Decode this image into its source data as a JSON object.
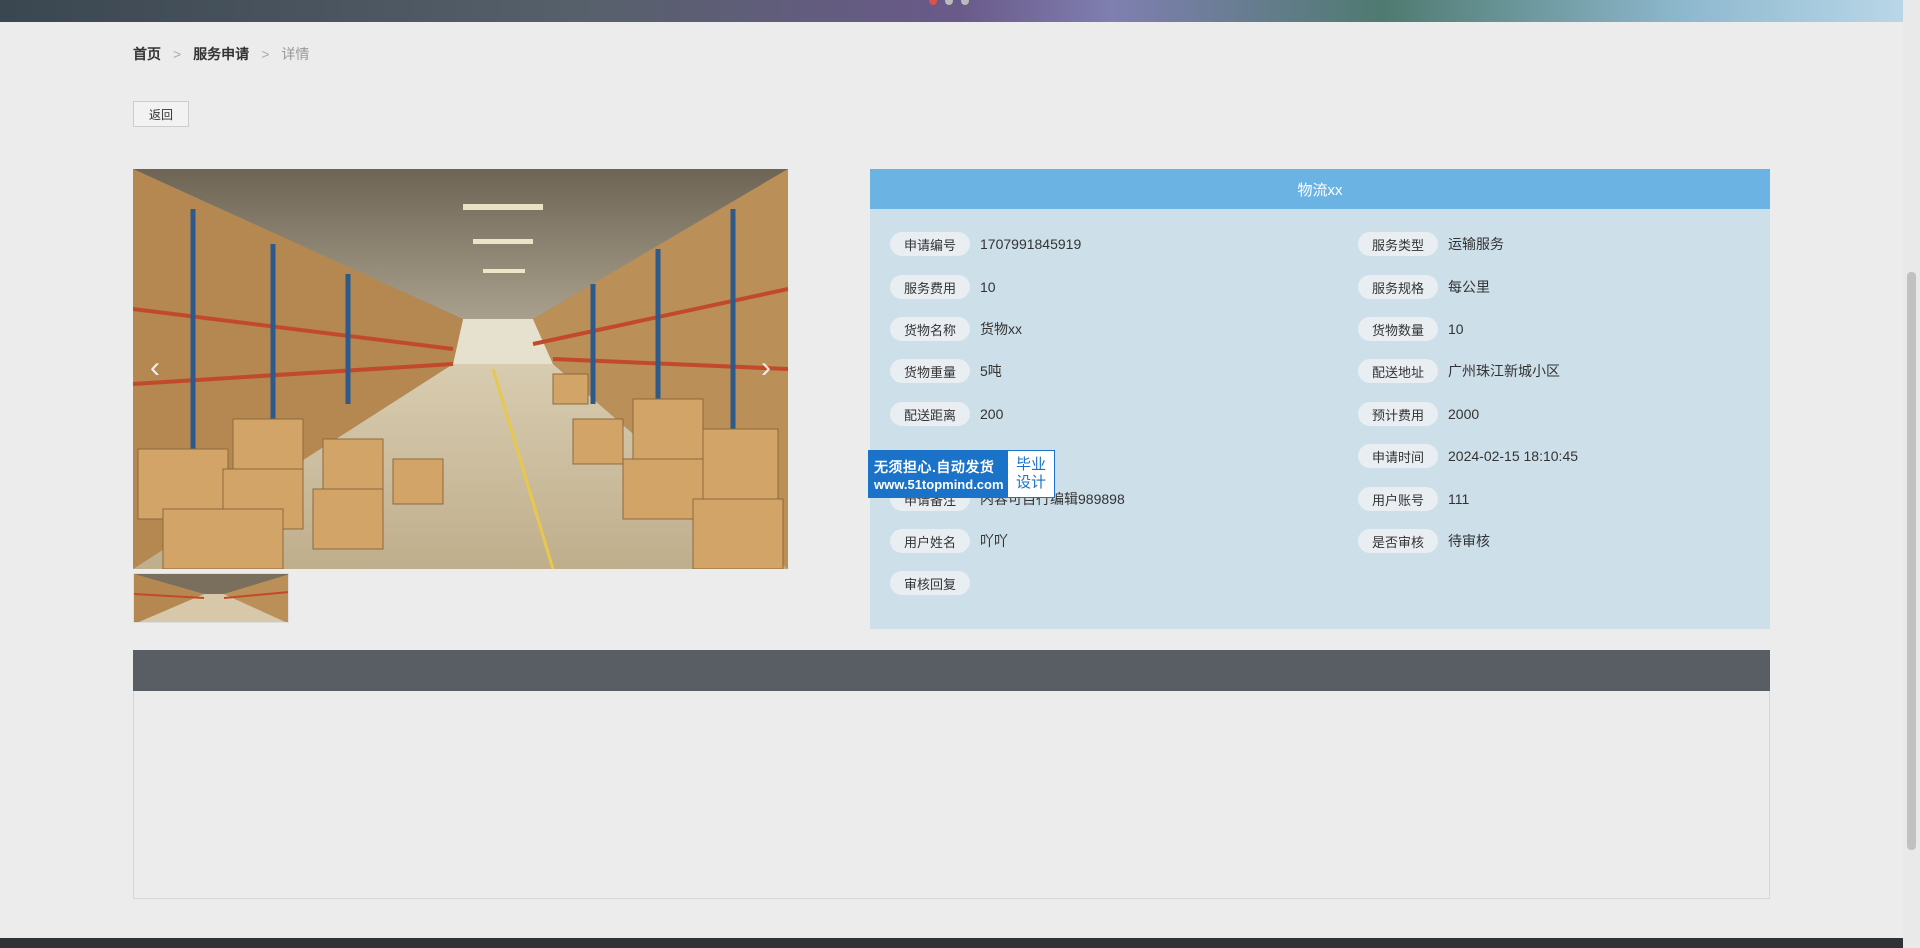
{
  "breadcrumb": {
    "home": "首页",
    "sep1": ">",
    "list": "服务申请",
    "sep2": ">",
    "current": "详情"
  },
  "back_button": "返回",
  "carousel": {
    "prev_icon": "chevron-left-icon",
    "next_icon": "chevron-right-icon",
    "slide_count": 3,
    "active_slide": 1
  },
  "info": {
    "title": "物流xx",
    "fields": {
      "apply_no": {
        "label": "申请编号",
        "value": "1707991845919"
      },
      "service_type": {
        "label": "服务类型",
        "value": "运输服务"
      },
      "service_fee": {
        "label": "服务费用",
        "value": "10"
      },
      "service_spec": {
        "label": "服务规格",
        "value": "每公里"
      },
      "goods_name": {
        "label": "货物名称",
        "value": "货物xx"
      },
      "goods_qty": {
        "label": "货物数量",
        "value": "10"
      },
      "goods_weight": {
        "label": "货物重量",
        "value": "5吨"
      },
      "address": {
        "label": "配送地址",
        "value": "广州珠江新城小区"
      },
      "distance": {
        "label": "配送距离",
        "value": "200"
      },
      "est_cost": {
        "label": "预计费用",
        "value": "2000"
      },
      "apply_time": {
        "label": "申请时间",
        "value": "2024-02-15 18:10:45"
      },
      "remark": {
        "label": "申请备注",
        "value": "内容可自行编辑989898"
      },
      "user_account": {
        "label": "用户账号",
        "value": "111"
      },
      "user_name": {
        "label": "用户姓名",
        "value": "吖吖"
      },
      "audit_status": {
        "label": "是否审核",
        "value": "待审核"
      },
      "audit_reply": {
        "label": "审核回复",
        "value": ""
      }
    }
  },
  "watermark": {
    "line1": "无须担心.自动发货",
    "line2": "www.51topmind.com",
    "right1": "毕业",
    "right2": "设计"
  },
  "colors": {
    "panel_title": "#6bb3e3",
    "panel_bg": "#cddfe9",
    "content_header": "#585e64",
    "watermark": "#1a73c8"
  }
}
